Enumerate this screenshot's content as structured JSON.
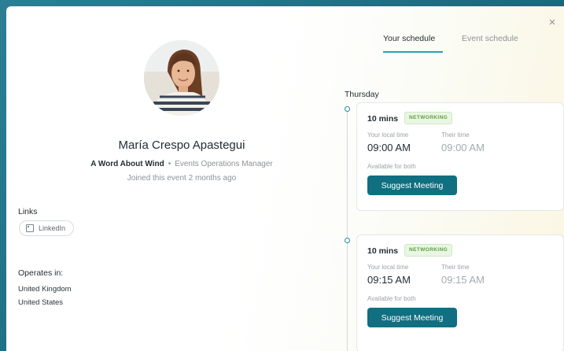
{
  "profile": {
    "name": "María Crespo Apastegui",
    "company": "A Word About Wind",
    "separator": "•",
    "role": "Events Operations Manager",
    "joined": "Joined this event 2 months ago"
  },
  "links": {
    "title": "Links",
    "items": [
      {
        "label": "LinkedIn",
        "icon": "linkedin-icon"
      }
    ]
  },
  "operates": {
    "title": "Operates in:",
    "countries": [
      "United Kingdom",
      "United States"
    ]
  },
  "tabs": [
    {
      "label": "Your schedule",
      "active": true
    },
    {
      "label": "Event schedule",
      "active": false
    }
  ],
  "close_icon": "×",
  "schedule": {
    "day": "Thursday",
    "slots": [
      {
        "duration": "10 mins",
        "badge": "NETWORKING",
        "local_label": "Your local time",
        "local_time": "09:00 AM",
        "their_label": "Their time",
        "their_time": "09:00 AM",
        "availability": "Available for both",
        "button": "Suggest Meeting"
      },
      {
        "duration": "10 mins",
        "badge": "NETWORKING",
        "local_label": "Your local time",
        "local_time": "09:15 AM",
        "their_label": "Their time",
        "their_time": "09:15 AM",
        "availability": "Available for both",
        "button": "Suggest Meeting"
      }
    ]
  },
  "colors": {
    "accent": "#106f80",
    "tab_underline": "#2aa0b0",
    "badge_text": "#5aa23d",
    "backdrop": "#1f6f86"
  }
}
